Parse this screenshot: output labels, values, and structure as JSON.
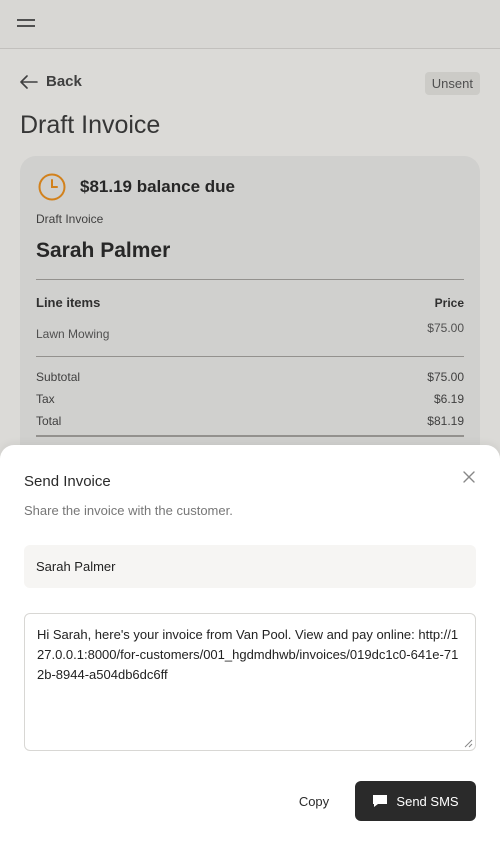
{
  "header": {
    "menu_icon": "hamburger-menu-icon"
  },
  "page": {
    "back_label": "Back",
    "status": "Unsent",
    "title": "Draft Invoice"
  },
  "invoice": {
    "balance_text": "$81.19 balance due",
    "subtitle": "Draft Invoice",
    "customer": "Sarah Palmer",
    "line_items_header": "Line items",
    "price_header": "Price",
    "items": [
      {
        "name": "Lawn Mowing",
        "price": "$75.00"
      }
    ],
    "summary": {
      "subtotal_label": "Subtotal",
      "subtotal": "$75.00",
      "tax_label": "Tax",
      "tax": "$6.19",
      "total_label": "Total",
      "total": "$81.19"
    }
  },
  "send_sheet": {
    "title": "Send Invoice",
    "description": "Share the invoice with the customer.",
    "recipient": "Sarah Palmer",
    "message": "Hi Sarah, here's your invoice from Van Pool. View and pay online: http://127.0.0.1:8000/for-customers/001_hgdmdhwb/invoices/019dc1c0-641e-712b-8944-a504db6dc6ff",
    "copy_label": "Copy",
    "send_label": "Send SMS"
  },
  "colors": {
    "accent_clock": "#e08a1e",
    "primary_button": "#2a2a2a"
  }
}
